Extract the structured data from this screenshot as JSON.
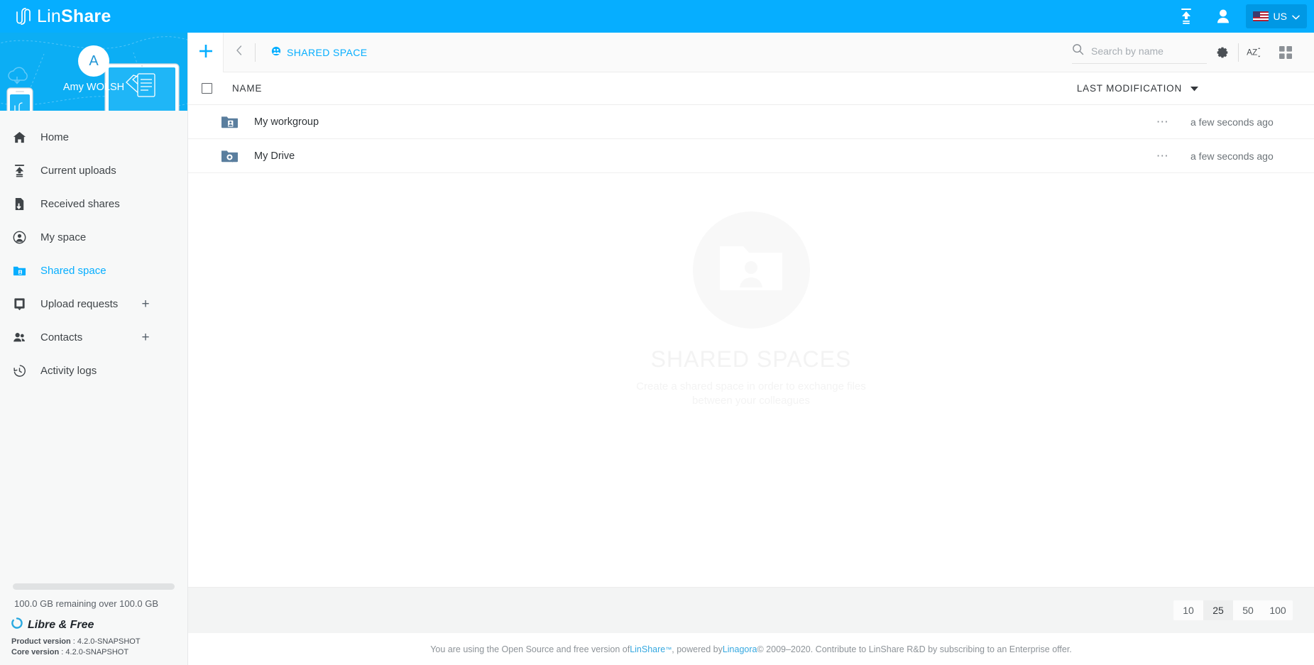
{
  "brand": {
    "name_thin": "Lin",
    "name_bold": "Share",
    "logo_icon": "linshare-logo-icon"
  },
  "topbar": {
    "upload_icon": "upload-icon",
    "account_icon": "user-account-icon",
    "language": {
      "label": "US",
      "flag_icon": "us-flag-icon",
      "chevron_icon": "chevron-down-icon"
    }
  },
  "sidebar": {
    "user": {
      "initial": "A",
      "name": "Amy WOLSH"
    },
    "items": [
      {
        "label": "Home",
        "icon": "home-icon",
        "active": false,
        "plus": false
      },
      {
        "label": "Current uploads",
        "icon": "upload-icon",
        "active": false,
        "plus": false
      },
      {
        "label": "Received shares",
        "icon": "received-shares-icon",
        "active": false,
        "plus": false
      },
      {
        "label": "My space",
        "icon": "user-circle-icon",
        "active": false,
        "plus": false
      },
      {
        "label": "Shared space",
        "icon": "shared-folder-icon",
        "active": true,
        "plus": false
      },
      {
        "label": "Upload requests",
        "icon": "upload-request-icon",
        "active": false,
        "plus": true
      },
      {
        "label": "Contacts",
        "icon": "contacts-icon",
        "active": false,
        "plus": true
      },
      {
        "label": "Activity logs",
        "icon": "history-clock-icon",
        "active": false,
        "plus": false
      }
    ],
    "storage_text": "100.0 GB remaining over 100.0 GB",
    "storage_percent": 0,
    "libre_label": "Libre & Free",
    "libre_icon": "libre-free-icon",
    "product_version_label": "Product version",
    "product_version_value": " : 4.2.0-SNAPSHOT",
    "core_version_label": "Core version",
    "core_version_value": " : 4.2.0-SNAPSHOT"
  },
  "toolbar": {
    "add_label": "+",
    "add_icon": "plus-icon",
    "back_icon": "chevron-left-icon",
    "breadcrumb_label": "SHARED SPACE",
    "breadcrumb_icon": "shared-space-icon",
    "settings_icon": "gear-icon",
    "sort_az_icon": "sort-alpha-icon",
    "grid_view_icon": "grid-view-icon"
  },
  "search": {
    "placeholder": "Search by name",
    "value": "",
    "icon": "search-icon"
  },
  "table": {
    "select_all_checkbox": "unchecked",
    "columns": {
      "name": "NAME",
      "last_modification": "LAST MODIFICATION"
    },
    "sort_icon": "caret-down-icon",
    "rows": [
      {
        "name": "My workgroup",
        "icon": "workgroup-folder-icon",
        "modified": "a few seconds ago",
        "menu_icon": "more-dots-icon"
      },
      {
        "name": "My Drive",
        "icon": "drive-folder-icon",
        "modified": "a few seconds ago",
        "menu_icon": "more-dots-icon"
      }
    ]
  },
  "empty_state": {
    "icon": "shared-space-placeholder-icon",
    "title": "SHARED SPACES",
    "subtitle": "Create a shared space in order to exchange files between your colleagues"
  },
  "pagination": {
    "options": [
      "10",
      "25",
      "50",
      "100"
    ],
    "selected": "25"
  },
  "footer": {
    "text_1": "You are using the Open Source and free version of ",
    "link_1": "LinShare",
    "tm": "™",
    "text_2": ", powered by ",
    "link_2": "Linagora",
    "text_3": " © 2009–2020. Contribute to LinShare R&D by subscribing to an Enterprise offer."
  },
  "colors": {
    "accent": "#06AEFF",
    "banner": "#0CAEF4",
    "folder": "#5A7E9E",
    "link": "#35A8E0"
  }
}
